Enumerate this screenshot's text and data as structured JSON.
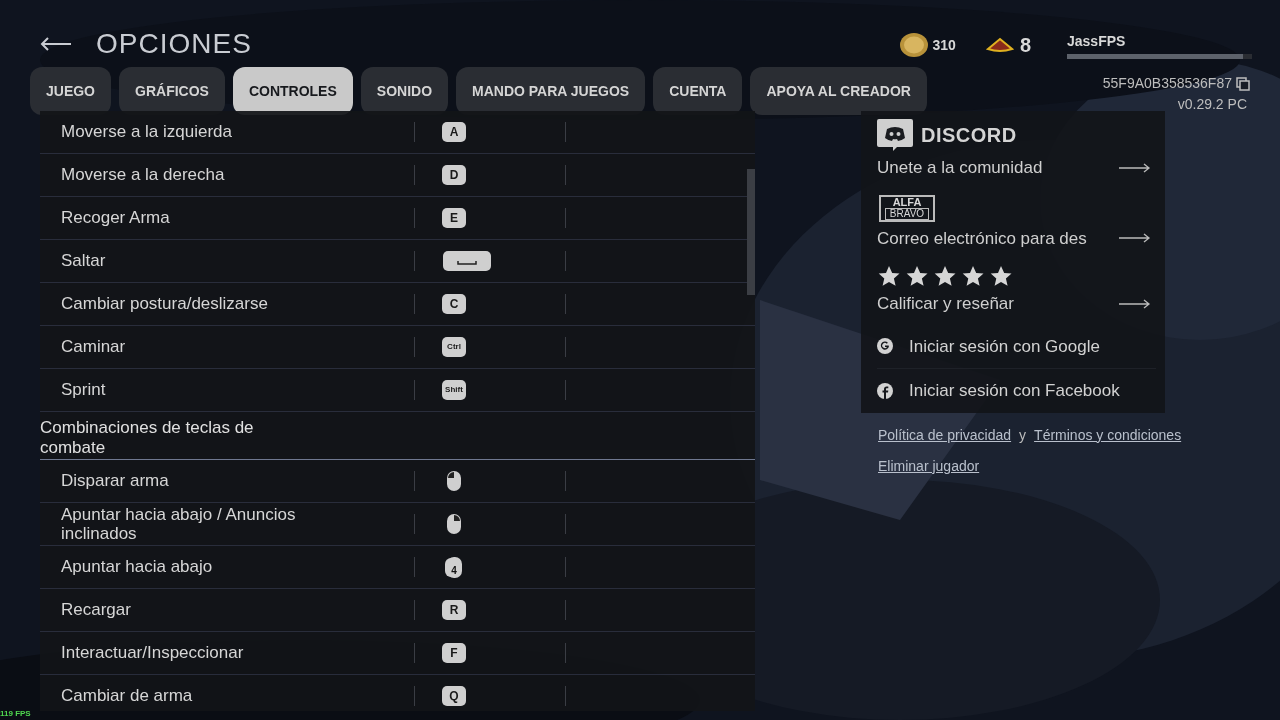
{
  "header": {
    "title": "OPCIONES"
  },
  "tabs": [
    {
      "label": "JUEGO",
      "selected": false
    },
    {
      "label": "GRÁFICOS",
      "selected": false
    },
    {
      "label": "CONTROLES",
      "selected": true
    },
    {
      "label": "SONIDO",
      "selected": false
    },
    {
      "label": "MANDO PARA JUEGOS",
      "selected": false
    },
    {
      "label": "CUENTA",
      "selected": false
    },
    {
      "label": "APOYA AL CREADOR",
      "selected": false
    }
  ],
  "player": {
    "coins": "310",
    "rank": "8",
    "name": "JassFPS",
    "xp": {
      "level": 0.95
    },
    "id": "55F9A0B358536F87",
    "version": "v0.29.2 PC"
  },
  "bindings": [
    {
      "kind": "row",
      "action": "Moverse a la izquierda",
      "key": {
        "kind": "key",
        "label": "A"
      }
    },
    {
      "kind": "row",
      "action": "Moverse a la derecha",
      "key": {
        "kind": "key",
        "label": "D"
      }
    },
    {
      "kind": "row",
      "action": "Recoger Arma",
      "key": {
        "kind": "key",
        "label": "E"
      }
    },
    {
      "kind": "row",
      "action": "Saltar",
      "key": {
        "kind": "space"
      }
    },
    {
      "kind": "row",
      "action": "Cambiar postura/deslizarse",
      "key": {
        "kind": "key",
        "label": "C"
      }
    },
    {
      "kind": "row",
      "action": "Caminar",
      "key": {
        "kind": "mod",
        "label": "Ctrl"
      }
    },
    {
      "kind": "row",
      "action": "Sprint",
      "key": {
        "kind": "mod",
        "label": "Shift"
      }
    },
    {
      "kind": "header",
      "title": "Combinaciones de teclas de combate"
    },
    {
      "kind": "row",
      "action": "Disparar arma",
      "key": {
        "kind": "mouse_left"
      }
    },
    {
      "kind": "row",
      "action": "Apuntar hacia abajo / Anuncios inclinados",
      "key": {
        "kind": "mouse_right"
      }
    },
    {
      "kind": "row",
      "action": "Apuntar hacia abajo",
      "key": {
        "kind": "mouse_side",
        "label": "4"
      }
    },
    {
      "kind": "row",
      "action": "Recargar",
      "key": {
        "kind": "key",
        "label": "R"
      }
    },
    {
      "kind": "row",
      "action": "Interactuar/Inspeccionar",
      "key": {
        "kind": "key",
        "label": "F"
      }
    },
    {
      "kind": "row",
      "action": "Cambiar de arma",
      "key": {
        "kind": "key",
        "label": "Q"
      }
    }
  ],
  "community": [
    {
      "kind": "discord",
      "logo": "DISCORD",
      "label": "Unete a la comunidad"
    },
    {
      "kind": "alfabravo",
      "logo": [
        "ALFA",
        "BRAVO"
      ],
      "label": "Correo electrónico para des"
    },
    {
      "kind": "rate",
      "stars": 5,
      "label": "Calificar y reseñar"
    }
  ],
  "logins": [
    {
      "kind": "google",
      "label": "Iniciar sesión con Google"
    },
    {
      "kind": "facebook",
      "label": "Iniciar sesión con Facebook"
    }
  ],
  "links": {
    "privacy": "Política de privacidad",
    "joiner": "y",
    "terms": "Términos y condiciones",
    "delete": "Eliminar jugador"
  },
  "fps": "119 FPS"
}
